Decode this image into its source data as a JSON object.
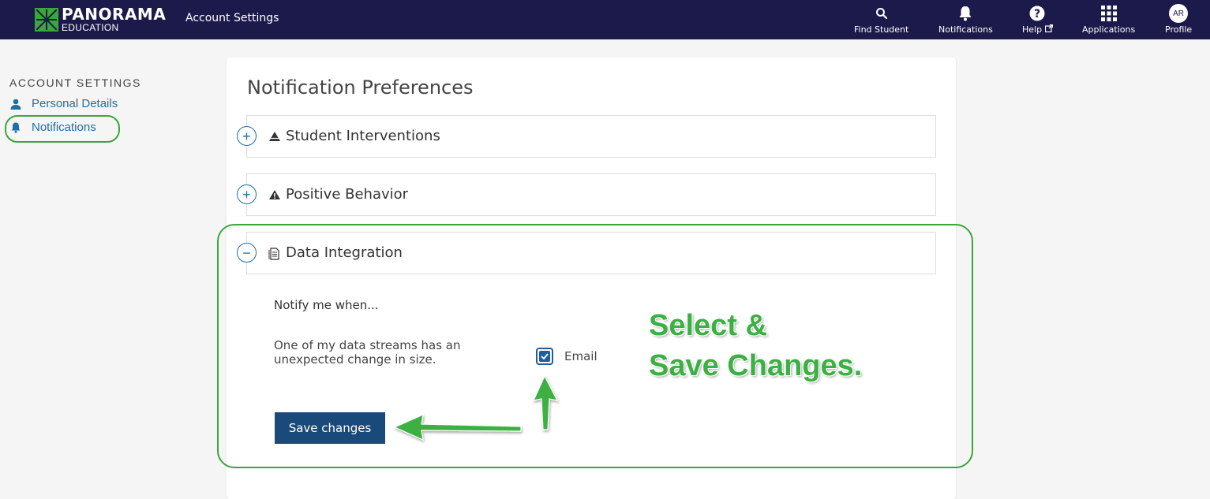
{
  "brand": {
    "name": "PANORAMA",
    "sub": "EDUCATION",
    "accent": "#3ba63a"
  },
  "header": {
    "title": "Account Settings",
    "nav": [
      {
        "label": "Find Student",
        "icon": "search-icon"
      },
      {
        "label": "Notifications",
        "icon": "bell-icon"
      },
      {
        "label": "Help",
        "icon": "help-icon"
      },
      {
        "label": "Applications",
        "icon": "grid-icon"
      },
      {
        "label": "Profile",
        "icon": "avatar",
        "initials": "AR"
      }
    ]
  },
  "sidebar": {
    "heading": "ACCOUNT SETTINGS",
    "items": [
      {
        "label": "Personal Details",
        "icon": "person-icon"
      },
      {
        "label": "Notifications",
        "icon": "bell-icon",
        "active": true
      }
    ]
  },
  "main": {
    "title": "Notification Preferences",
    "sections": [
      {
        "title": "Student Interventions",
        "icon": "triangle-icon",
        "expanded": false
      },
      {
        "title": "Positive Behavior",
        "icon": "warning-icon",
        "expanded": false
      },
      {
        "title": "Data Integration",
        "icon": "document-icon",
        "expanded": true
      }
    ],
    "data_integration": {
      "notify_label": "Notify me when...",
      "description": "One of my data streams has an unexpected change in size.",
      "email_label": "Email",
      "email_checked": true,
      "save_label": "Save changes"
    }
  },
  "annotation": {
    "line1": "Select &",
    "line2": "Save Changes."
  }
}
